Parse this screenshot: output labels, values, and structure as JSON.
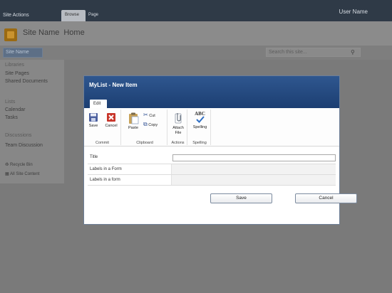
{
  "topbar": {
    "site_actions": "Site Actions",
    "tabs": [
      {
        "label": "Browse"
      },
      {
        "label": "Page"
      }
    ],
    "user_name": "User Name"
  },
  "site": {
    "name": "Site Name",
    "page": "Home"
  },
  "navbar": {
    "nav_label": "Site Name",
    "search_placeholder": "Search this site..."
  },
  "leftnav": {
    "libraries_heading": "Libraries",
    "libraries": [
      "Site Pages",
      "Shared Documents"
    ],
    "lists_heading": "Lists",
    "lists": [
      "Calendar",
      "Tasks"
    ],
    "discussions_heading": "Discussions",
    "discussions": [
      "Team Discussion"
    ],
    "recycle_bin": "Recycle Bin",
    "all_site_content": "All Site Content"
  },
  "modal": {
    "title": "MyList - New Item",
    "tab": "Edit",
    "ribbon": {
      "commit_label": "Commit",
      "save": "Save",
      "cancel": "Cancel",
      "clipboard_label": "Clipboard",
      "paste": "Paste",
      "cut": "Cut",
      "copy": "Copy",
      "actions_label": "Actions",
      "attach_line1": "Attach",
      "attach_line2": "File",
      "spelling_label": "Spelling",
      "spelling": "Spelling",
      "abc": "ABC"
    },
    "fields": [
      {
        "label": "Title",
        "value": ""
      },
      {
        "label": "Labels  in a Form"
      },
      {
        "label": "Labels  in a form"
      }
    ],
    "save_button": "Save",
    "cancel_button": "Cancel"
  },
  "colors": {
    "ribbon_dark": "#2f3a47",
    "dialog_header": "#2a4f86",
    "dim_overlay": "#7a7a7a"
  }
}
